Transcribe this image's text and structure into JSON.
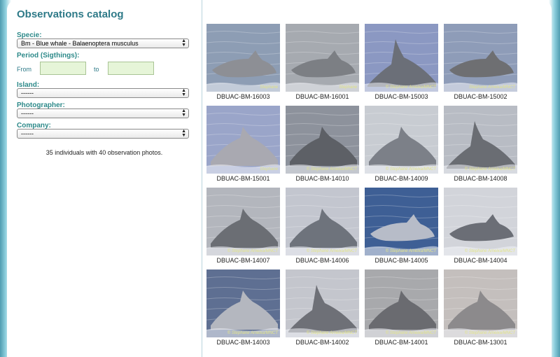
{
  "title": "Observations catalog",
  "filters": {
    "specie_label": "Specie:",
    "specie_value": "Bm - Blue whale - Balaenoptera musculus",
    "period_label": "Period (Sigthings):",
    "from_label": "From",
    "to_label": "to",
    "from_value": "",
    "to_value": "",
    "island_label": "Island:",
    "island_value": "------",
    "photographer_label": "Photographer:",
    "photographer_value": "------",
    "company_label": "Company:",
    "company_value": "------"
  },
  "summary": "35 individuals with 40 observation photos.",
  "photos": [
    {
      "id": "DBUAC-BM-16003",
      "sea": "#8d9db4",
      "whale": "#8d8f95",
      "shape": "low",
      "wm": "Stephane"
    },
    {
      "id": "DBUAC-BM-16001",
      "sea": "#a6aab0",
      "whale": "#7c7f84",
      "shape": "low",
      "wm": "Stephane"
    },
    {
      "id": "DBUAC-BM-15003",
      "sea": "#8b98c2",
      "whale": "#6b6f78",
      "shape": "fin",
      "wm": "© Stephane Ameixa/MNCT"
    },
    {
      "id": "DBUAC-BM-15002",
      "sea": "#8e9cb8",
      "whale": "#6e6f72",
      "shape": "low",
      "wm": "Stephane Ameixa/MNCT"
    },
    {
      "id": "DBUAC-BM-15001",
      "sea": "#9aa5c9",
      "whale": "#a9a9b1",
      "shape": "back",
      "wm": "Stephane"
    },
    {
      "id": "DBUAC-BM-14010",
      "sea": "#8d929c",
      "whale": "#5d6066",
      "shape": "back",
      "wm": "© Stephane Ameixa/MNCT"
    },
    {
      "id": "DBUAC-BM-14009",
      "sea": "#c8ccd2",
      "whale": "#7c8088",
      "shape": "back",
      "wm": "© Stephane Ameixa/MNCT"
    },
    {
      "id": "DBUAC-BM-14008",
      "sea": "#b8bcc4",
      "whale": "#6a6d73",
      "shape": "fin",
      "wm": "© Stephane Ameixa/MNCT"
    },
    {
      "id": "DBUAC-BM-14007",
      "sea": "#b3b6bd",
      "whale": "#6b6e74",
      "shape": "back",
      "wm": "© Stephane Ameixa/MNCT"
    },
    {
      "id": "DBUAC-BM-14006",
      "sea": "#c3c6cf",
      "whale": "#6e737c",
      "shape": "back",
      "wm": "© Stephane Ameixa/MNCT"
    },
    {
      "id": "DBUAC-BM-14005",
      "sea": "#3e5f95",
      "whale": "#b7bcc8",
      "shape": "low",
      "wm": "© Stephane Ameixa/MNCT"
    },
    {
      "id": "DBUAC-BM-14004",
      "sea": "#d2d4da",
      "whale": "#6b6e76",
      "shape": "low",
      "wm": "© Stephane Ameixa/MNCT"
    },
    {
      "id": "DBUAC-BM-14003",
      "sea": "#5e6f92",
      "whale": "#b4b7bf",
      "shape": "back",
      "wm": "© Stephane Ameixa/MNCT"
    },
    {
      "id": "DBUAC-BM-14002",
      "sea": "#c4c6cd",
      "whale": "#6e7077",
      "shape": "fin",
      "wm": "© Stephane Ameixa/MNCT"
    },
    {
      "id": "DBUAC-BM-14001",
      "sea": "#a8a9ac",
      "whale": "#6a6b70",
      "shape": "back",
      "wm": "© Stephane Ameixa/MNCT"
    },
    {
      "id": "DBUAC-BM-13001",
      "sea": "#c4bfbd",
      "whale": "#8c8a8c",
      "shape": "back",
      "wm": "© Stephane Ameixa/MNCT"
    }
  ]
}
